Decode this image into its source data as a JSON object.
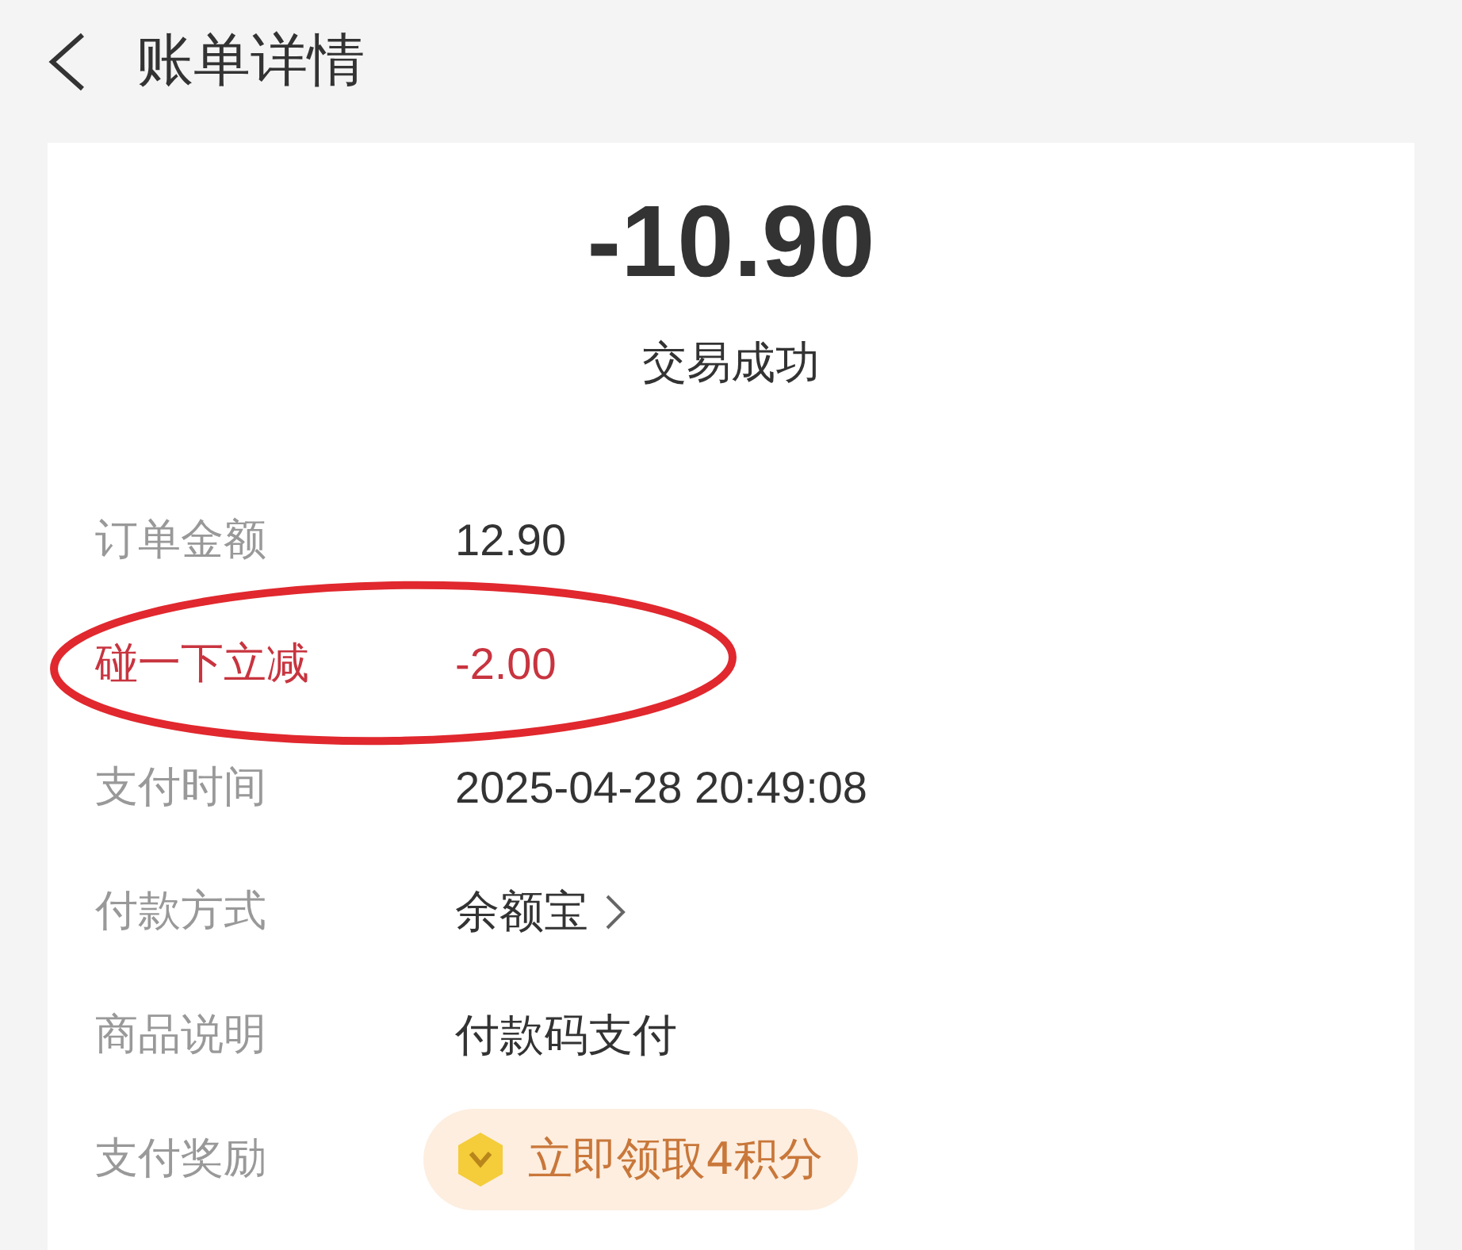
{
  "header": {
    "title": "账单详情"
  },
  "summary": {
    "amount": "-10.90",
    "status": "交易成功"
  },
  "rows": [
    {
      "kind": "text",
      "label": "订单金额",
      "value": "12.90",
      "highlighted": false,
      "circled": false
    },
    {
      "kind": "text",
      "label": "碰一下立减",
      "value": "-2.00",
      "highlighted": true,
      "circled": true
    },
    {
      "kind": "text",
      "label": "支付时间",
      "value": "2025-04-28 20:49:08",
      "highlighted": false,
      "circled": false
    },
    {
      "kind": "link",
      "label": "付款方式",
      "value": "余额宝",
      "highlighted": false,
      "circled": false
    },
    {
      "kind": "text",
      "label": "商品说明",
      "value": "付款码支付",
      "highlighted": false,
      "circled": false
    },
    {
      "kind": "reward",
      "label": "支付奖励",
      "value": "立即领取4积分",
      "highlighted": false,
      "circled": false
    }
  ]
}
